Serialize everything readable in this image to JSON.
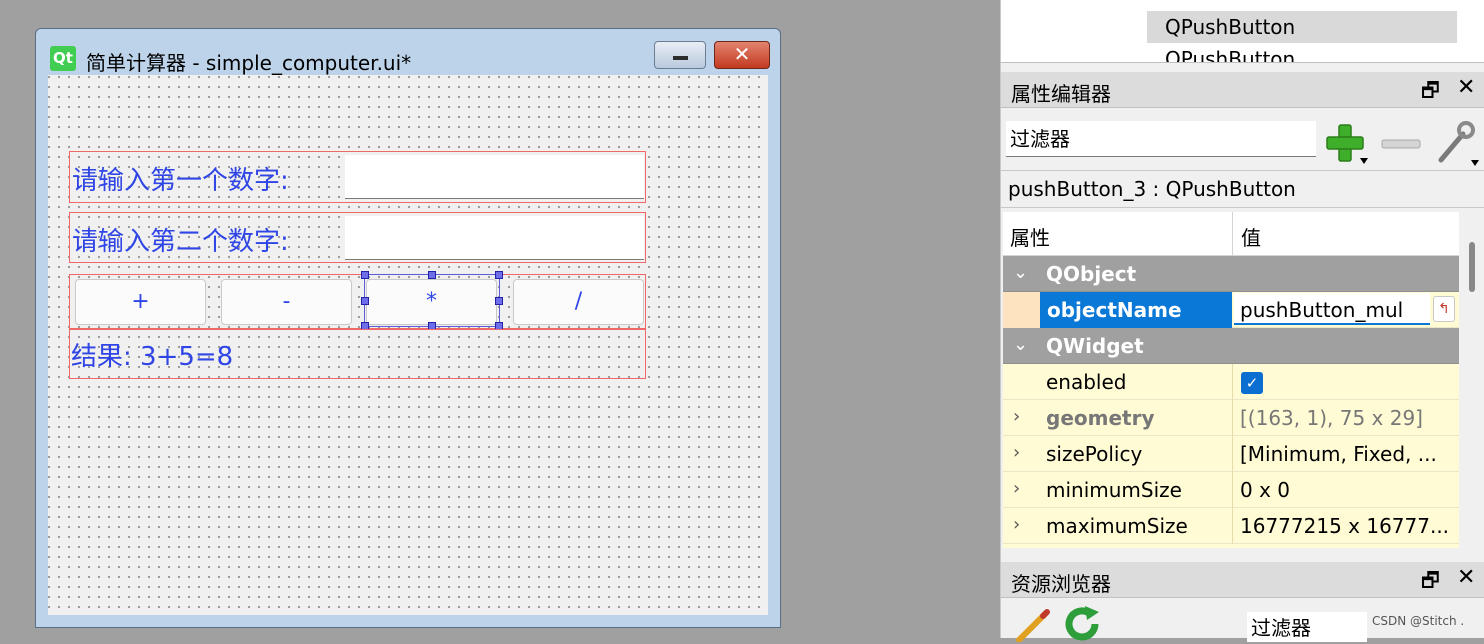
{
  "form_window": {
    "logo": "Qt",
    "title": "简单计算器 - simple_computer.ui*",
    "close_glyph": "✕",
    "label1": "请输入第一个数字:",
    "label2": "请输入第二个数字:",
    "buttons": [
      {
        "label": "+"
      },
      {
        "label": "-"
      },
      {
        "label": "*"
      },
      {
        "label": "/"
      }
    ],
    "result_label": "结果: 3+5=8"
  },
  "object_inspector": {
    "items": [
      {
        "label": "QPushButton",
        "selected": true
      },
      {
        "label": "QPushButton",
        "selected": false
      }
    ]
  },
  "property_editor": {
    "title": "属性编辑器",
    "float_glyph": "🗗",
    "close_glyph": "✕",
    "filter_text": "过滤器",
    "object_class": "pushButton_3 : QPushButton",
    "header": {
      "property": "属性",
      "value": "值"
    },
    "groups": [
      {
        "name": "QObject"
      },
      {
        "name": "QWidget"
      }
    ],
    "rows": {
      "objectName": {
        "name": "objectName",
        "value": "pushButton_mul"
      },
      "enabled": {
        "name": "enabled",
        "value": "✓"
      },
      "geometry": {
        "name": "geometry",
        "value": "[(163, 1), 75 x 29]"
      },
      "sizePolicy": {
        "name": "sizePolicy",
        "value": "[Minimum, Fixed, ..."
      },
      "minimumSize": {
        "name": "minimumSize",
        "value": "0 x 0"
      },
      "maximumSize": {
        "name": "maximumSize",
        "value": "16777215 x 16777..."
      }
    },
    "expand_glyph": "⌄",
    "collapsed_glyph": "›",
    "reset_glyph": "↰"
  },
  "resource_browser": {
    "title": "资源浏览器",
    "float_glyph": "🗗",
    "close_glyph": "✕",
    "filter_text": "过滤器"
  },
  "watermark": "CSDN @Stitch .",
  "colors": {
    "label_blue": "#2f45e6",
    "layout_red": "#f06868",
    "selection_blue": "#0a78d7",
    "qt_green": "#41cd52"
  }
}
